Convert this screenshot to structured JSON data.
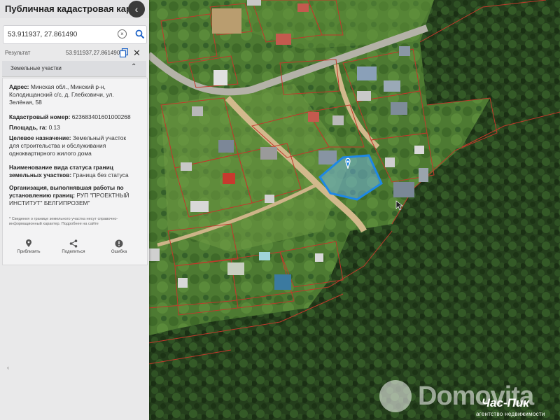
{
  "app": {
    "title": "Публичная кадастровая карта"
  },
  "search": {
    "value": "53.911937, 27.861490"
  },
  "result": {
    "label": "Результат",
    "coords": "53.911937,27.861490"
  },
  "section": {
    "label": "Земельные участки"
  },
  "parcel": {
    "address_label": "Адрес:",
    "address_value": "Минская обл., Минский р-н, Колодищанский с/с, д. Глебковичи, ул. Зелёная, 58",
    "cadastral_label": "Кадастровый номер:",
    "cadastral_value": "623683401601000268",
    "area_label": "Площадь, га:",
    "area_value": "0.13",
    "purpose_label": "Целевое назначение:",
    "purpose_value": "Земельный участок для строительства и обслуживания одноквартирного жилого дома",
    "border_status_label": "Наименование вида статуса границ земельных участков:",
    "border_status_value": "Граница без статуса",
    "org_label": "Организация, выполнявшая работы по установлению границ:",
    "org_value": "РУП \"ПРОЕКТНЫЙ ИНСТИТУТ\" БЕЛГИПРОЗЕМ\"",
    "note": "* Сведения о границе земельного участка несут справочно-информационный характер. Подробнее на сайте"
  },
  "actions": {
    "zoom": "Приблизить",
    "share": "Поделиться",
    "error": "Ошибка"
  },
  "bottom_tick": "‹",
  "watermark": {
    "brand": "Domovita",
    "logo": "Час-Пик",
    "sub": "агентство недвижимости"
  },
  "icons": {
    "back": "chevron-left-icon",
    "clear": "clear-circle-icon",
    "search": "search-icon",
    "copy": "copy-icon",
    "close": "close-icon",
    "collapse": "chevron-up-icon",
    "zoom": "location-pin-icon",
    "share": "share-icon",
    "error": "error-icon",
    "marker": "map-marker-icon",
    "cursor": "cursor-icon"
  },
  "colors": {
    "parcel_border": "#c0392b",
    "selected_parcel": "#1e88e5",
    "panel_bg": "#e9e9ea"
  }
}
